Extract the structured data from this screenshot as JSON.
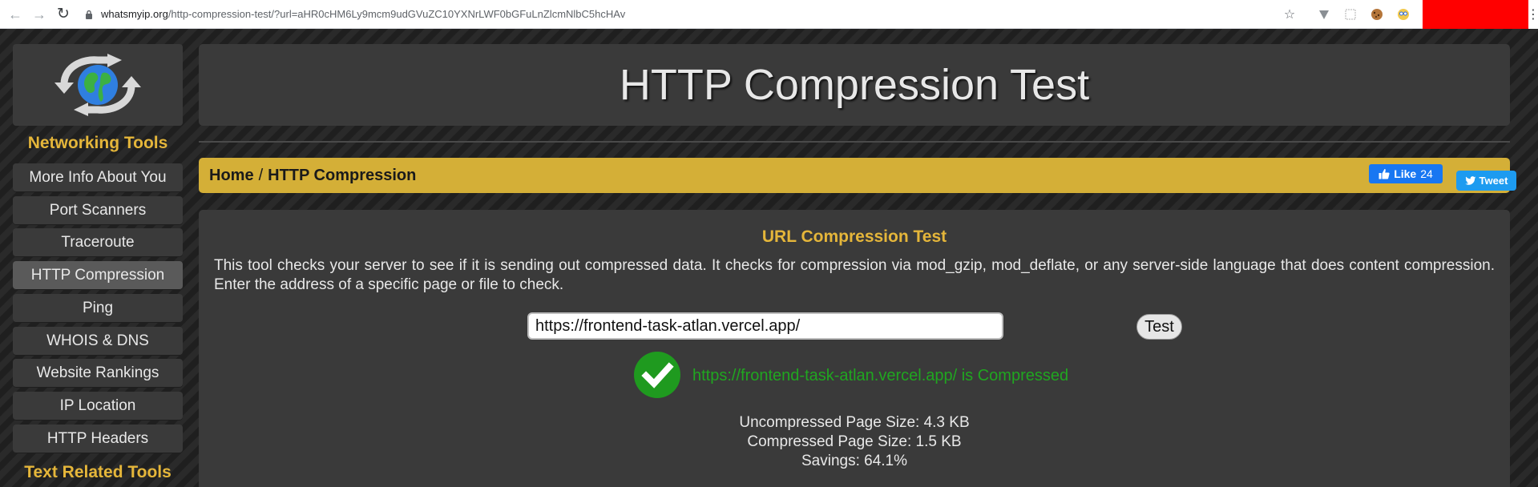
{
  "browser": {
    "url_domain": "whatsmyip.org",
    "url_path": "/http-compression-test/?url=aHR0cHM6Ly9mcm9udGVuZC10YXNrLWF0bGFuLnZlcmNlbC5hcHAv"
  },
  "sidebar": {
    "heading_networking": "Networking Tools",
    "heading_text": "Text Related Tools",
    "items": [
      {
        "label": "More Info About You"
      },
      {
        "label": "Port Scanners"
      },
      {
        "label": "Traceroute"
      },
      {
        "label": "HTTP Compression"
      },
      {
        "label": "Ping"
      },
      {
        "label": "WHOIS & DNS"
      },
      {
        "label": "Website Rankings"
      },
      {
        "label": "IP Location"
      },
      {
        "label": "HTTP Headers"
      }
    ]
  },
  "header": {
    "title": "HTTP Compression Test"
  },
  "breadcrumb": {
    "home": "Home",
    "separator": "/",
    "current": "HTTP Compression"
  },
  "social": {
    "like_label": "Like",
    "like_count": "24",
    "tweet_label": "Tweet"
  },
  "main": {
    "section_title": "URL Compression Test",
    "description": "This tool checks your server to see if it is sending out compressed data. It checks for compression via mod_gzip, mod_deflate, or any server-side language that does content compression. Enter the address of a specific page or file to check.",
    "url_value": "https://frontend-task-atlan.vercel.app/",
    "test_button": "Test",
    "result_text": "https://frontend-task-atlan.vercel.app/ is Compressed",
    "uncompressed": "Uncompressed Page Size: 4.3 KB",
    "compressed": "Compressed Page Size: 1.5 KB",
    "savings": "Savings: 64.1%"
  },
  "colors": {
    "accent": "#d4af37",
    "heading": "#e5b63a",
    "success": "#20a620",
    "panel": "#3a3a3a"
  }
}
